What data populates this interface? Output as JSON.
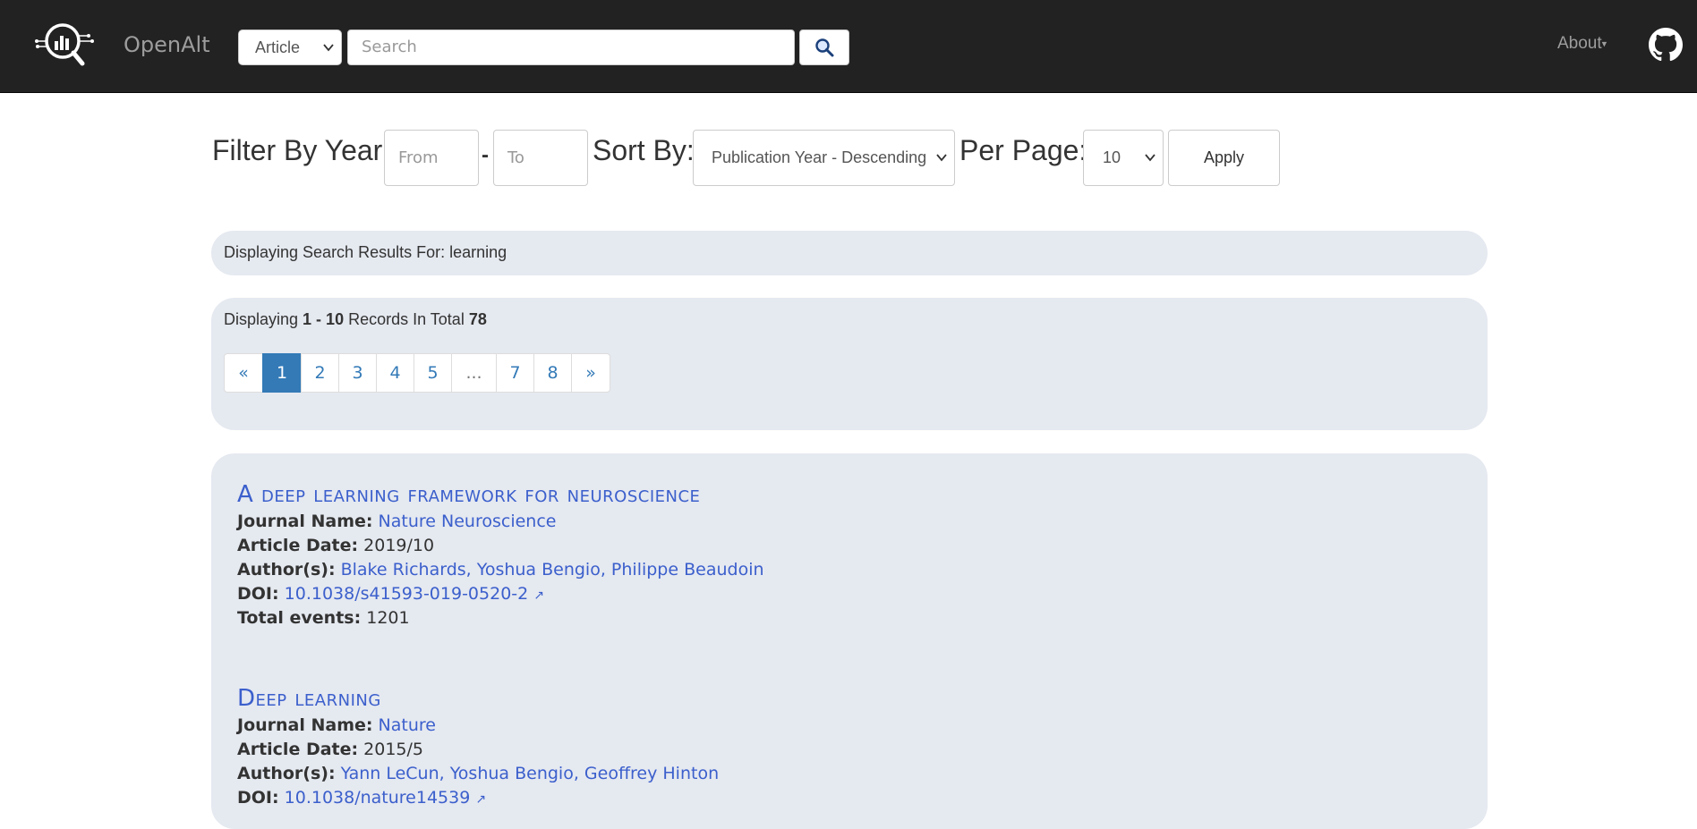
{
  "navbar": {
    "brand": "OpenAlt",
    "type_select": "Article",
    "search_placeholder": "Search",
    "about_label": "About"
  },
  "filters": {
    "filter_label": "Filter By Year:",
    "from_placeholder": "From",
    "to_placeholder": "To",
    "dash": "-",
    "sort_label": "Sort By:",
    "sort_value": "Publication Year - Descending",
    "per_page_label": "Per Page:",
    "per_page_value": "10",
    "apply_label": "Apply"
  },
  "search_info": {
    "prefix": "Displaying Search Results For: ",
    "query": "learning"
  },
  "records": {
    "prefix": "Displaying ",
    "range": "1 - 10",
    "middle": " Records In Total ",
    "total": "78"
  },
  "pagination": [
    "«",
    "1",
    "2",
    "3",
    "4",
    "5",
    "...",
    "7",
    "8",
    "»"
  ],
  "results": [
    {
      "title": "A deep learning framework for neuroscience",
      "journal_label": "Journal Name:",
      "journal": "Nature Neuroscience",
      "date_label": "Article Date:",
      "date": "2019/10",
      "authors_label": "Author(s):",
      "authors": "Blake Richards, Yoshua Bengio, Philippe Beaudoin",
      "doi_label": "DOI:",
      "doi": "10.1038/s41593-019-0520-2",
      "events_label": "Total events:",
      "events": "1201"
    },
    {
      "title": "Deep learning",
      "journal_label": "Journal Name:",
      "journal": "Nature",
      "date_label": "Article Date:",
      "date": "2015/5",
      "authors_label": "Author(s):",
      "authors": "Yann LeCun, Yoshua Bengio, Geoffrey Hinton",
      "doi_label": "DOI:",
      "doi": "10.1038/nature14539"
    }
  ]
}
